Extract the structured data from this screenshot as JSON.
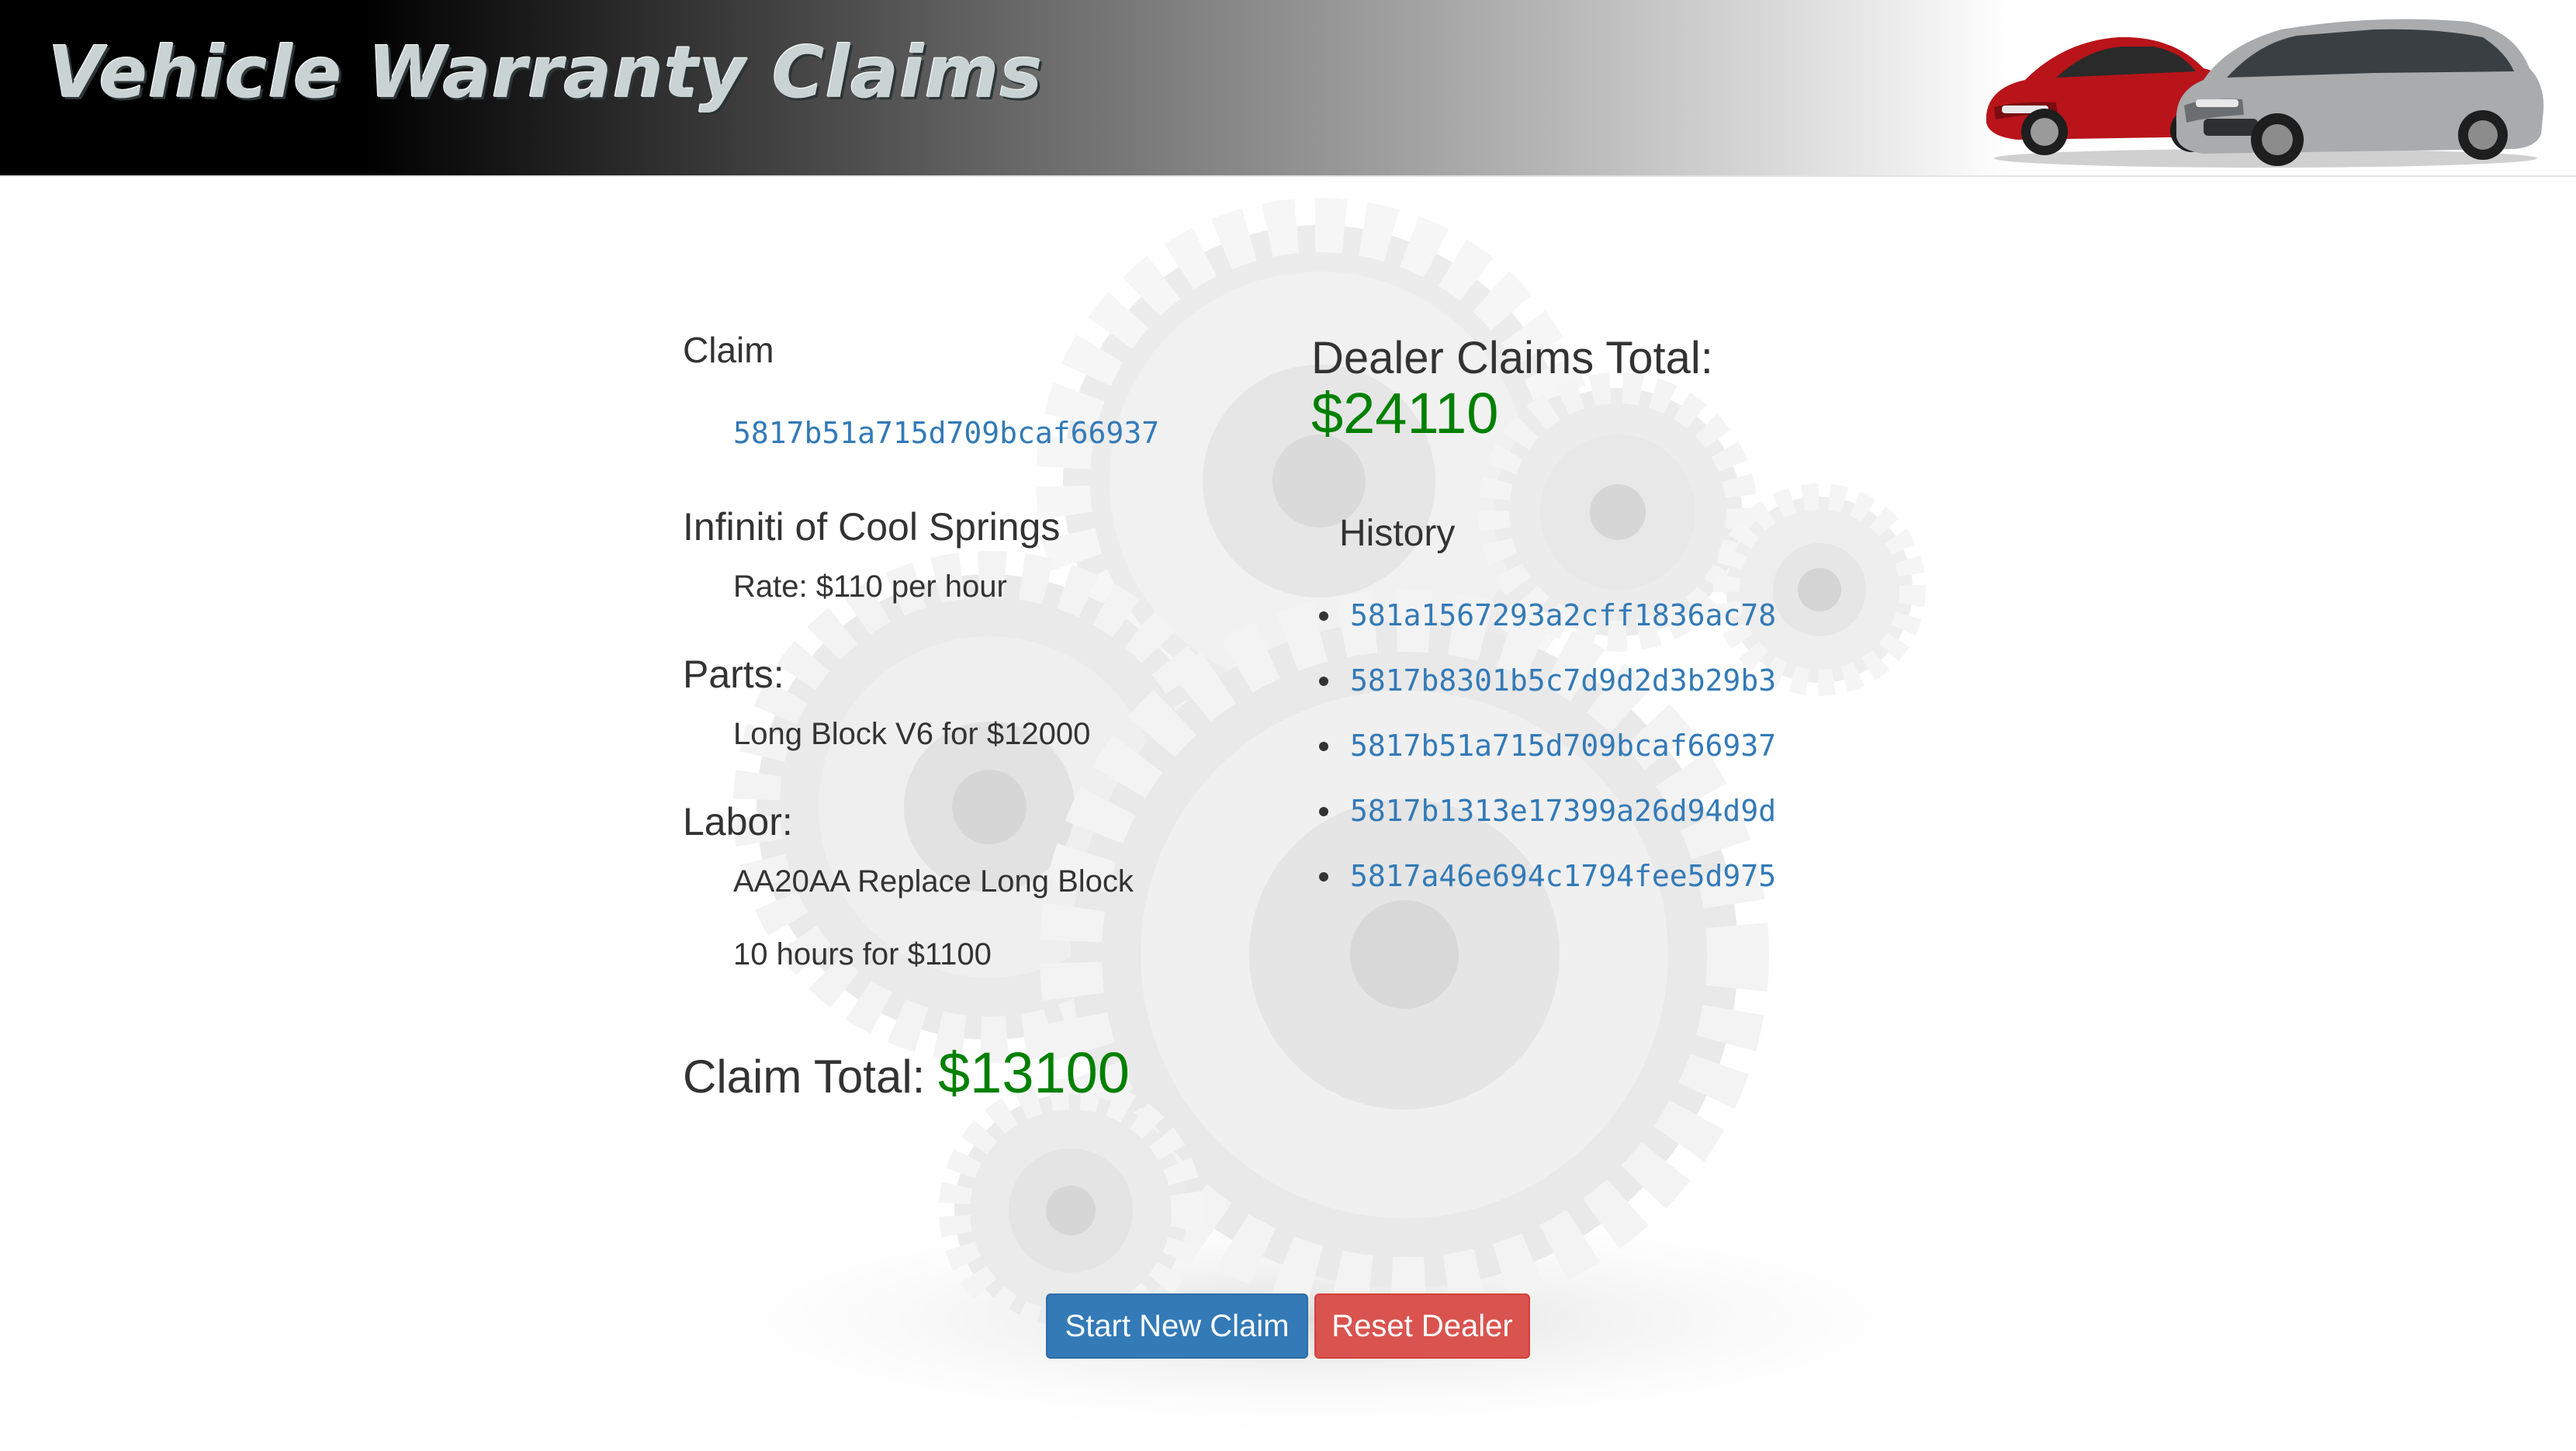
{
  "header": {
    "title": "Vehicle Warranty Claims"
  },
  "claim": {
    "label": "Claim",
    "id": "5817b51a715d709bcaf66937"
  },
  "dealer": {
    "name": "Infiniti of Cool Springs",
    "rate": "Rate: $110 per hour"
  },
  "parts": {
    "label": "Parts:",
    "item": "Long Block V6 for $12000"
  },
  "labor": {
    "label": "Labor:",
    "operation": "AA20AA Replace Long Block",
    "hours": "10 hours for $1100"
  },
  "claim_total": {
    "label": "Claim Total:",
    "value": "$13100"
  },
  "dealer_total": {
    "label": "Dealer Claims Total:",
    "value": "$24110"
  },
  "history": {
    "label": "History",
    "items": [
      "581a1567293a2cff1836ac78",
      "5817b8301b5c7d9d2d3b29b3",
      "5817b51a715d709bcaf66937",
      "5817b1313e17399a26d94d9d",
      "5817a46e694c1794fee5d975"
    ]
  },
  "buttons": {
    "start_new_claim": "Start New Claim",
    "reset_dealer": "Reset Dealer"
  },
  "colors": {
    "link": "#337ab7",
    "money": "#008000",
    "primary_button": "#337ab7",
    "danger_button": "#d9534f"
  }
}
